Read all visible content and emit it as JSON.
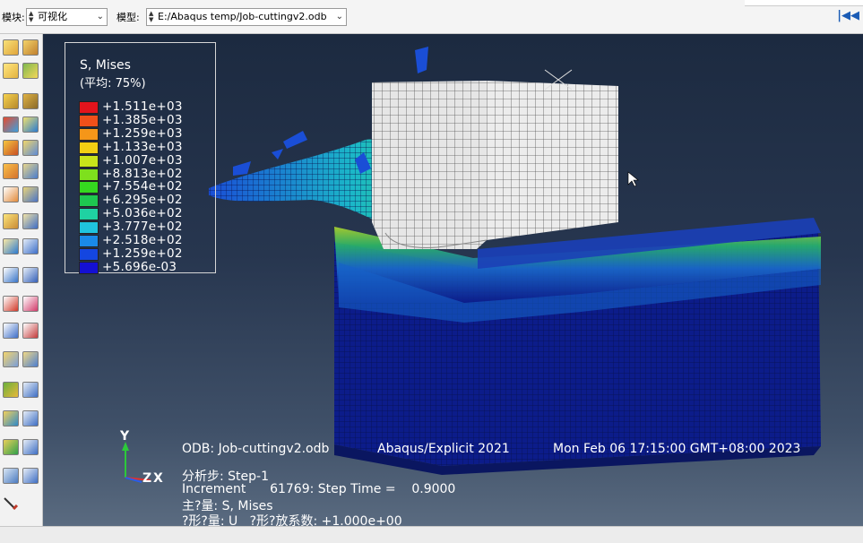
{
  "toolbar": {
    "module_label": "模块:",
    "module_value": "可视化",
    "model_label": "模型:",
    "model_value": "E:/Abaqus temp/Job-cuttingv2.odb",
    "nav_last_icon": "skip-to-last-icon"
  },
  "legend": {
    "title": "S, Mises",
    "subtitle": "(平均: 75%)",
    "entries": [
      {
        "label": "+1.511e+03",
        "color": "#e3141c"
      },
      {
        "label": "+1.385e+03",
        "color": "#f0501a"
      },
      {
        "label": "+1.259e+03",
        "color": "#f59619"
      },
      {
        "label": "+1.133e+03",
        "color": "#f2cf13"
      },
      {
        "label": "+1.007e+03",
        "color": "#c9e51a"
      },
      {
        "label": "+8.813e+02",
        "color": "#7ee01d"
      },
      {
        "label": "+7.554e+02",
        "color": "#35d81f"
      },
      {
        "label": "+6.295e+02",
        "color": "#1ec850"
      },
      {
        "label": "+5.036e+02",
        "color": "#1fd2a2"
      },
      {
        "label": "+3.777e+02",
        "color": "#1fc4de"
      },
      {
        "label": "+2.518e+02",
        "color": "#1a8ae8"
      },
      {
        "label": "+1.259e+02",
        "color": "#1446e0"
      },
      {
        "label": "+5.696e-03",
        "color": "#1410d2"
      }
    ]
  },
  "triad": {
    "y": "Y",
    "z": "Z",
    "x": "X"
  },
  "info": {
    "odb": "ODB: Job-cuttingv2.odb",
    "solver": "Abaqus/Explicit 2021",
    "datetime": "Mon Feb 06 17:15:00 GMT+08:00 2023",
    "step": "分析步: Step-1",
    "increment": "Increment      61769: Step Time =    0.9000",
    "primary": "主?量: S, Mises",
    "deformed": "?形?量: U   ?形?放系数: +1.000e+00"
  },
  "colors": {
    "workpiece": "#0c1c8a",
    "tool": "#e8e8e8",
    "background_top": "#1c2a40"
  }
}
